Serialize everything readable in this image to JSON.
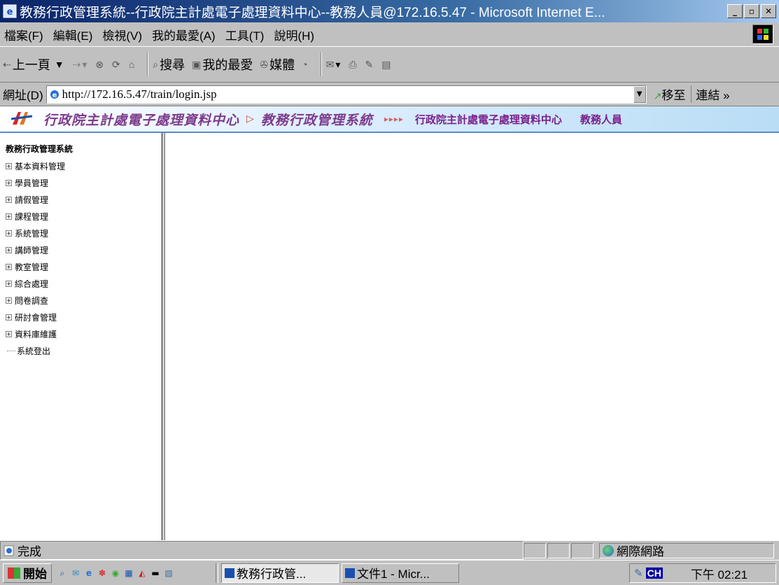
{
  "window": {
    "title": "教務行政管理系統--行政院主計處電子處理資料中心--教務人員@172.16.5.47 - Microsoft Internet E...",
    "minimize_label": "_",
    "maximize_label": "▫",
    "close_label": "✕"
  },
  "menu": {
    "items": [
      "檔案(F)",
      "編輯(E)",
      "檢視(V)",
      "我的最愛(A)",
      "工具(T)",
      "說明(H)"
    ]
  },
  "toolbar": {
    "back_label": "上一頁",
    "search_label": "搜尋",
    "favorites_label": "我的最愛",
    "media_label": "媒體"
  },
  "address": {
    "label": "網址(D)",
    "url": "http://172.16.5.47/train/login.jsp",
    "go_label": "移至",
    "links_label": "連結"
  },
  "banner": {
    "left_text1": "行政院主計處電子處理資料中心",
    "left_text2": "教務行政管理系統",
    "right_org": "行政院主計處電子處理資料中心",
    "right_role": "教務人員"
  },
  "sidebar": {
    "title": "教務行政管理系統",
    "items": [
      {
        "label": "基本資料管理"
      },
      {
        "label": "學員管理"
      },
      {
        "label": "請假管理"
      },
      {
        "label": "課程管理"
      },
      {
        "label": "系統管理"
      },
      {
        "label": "講師管理"
      },
      {
        "label": "教室管理"
      },
      {
        "label": "綜合處理"
      },
      {
        "label": "問卷調查"
      },
      {
        "label": "研討會管理"
      },
      {
        "label": "資料庫維護"
      }
    ],
    "logout_label": "系統登出"
  },
  "status": {
    "text": "完成",
    "zone": "網際網路"
  },
  "taskbar": {
    "start_label": "開始",
    "tasks": [
      {
        "label": "教務行政管..."
      },
      {
        "label": "文件1 - Micr..."
      }
    ],
    "ime_label": "CH",
    "clock": "下午 02:21"
  }
}
